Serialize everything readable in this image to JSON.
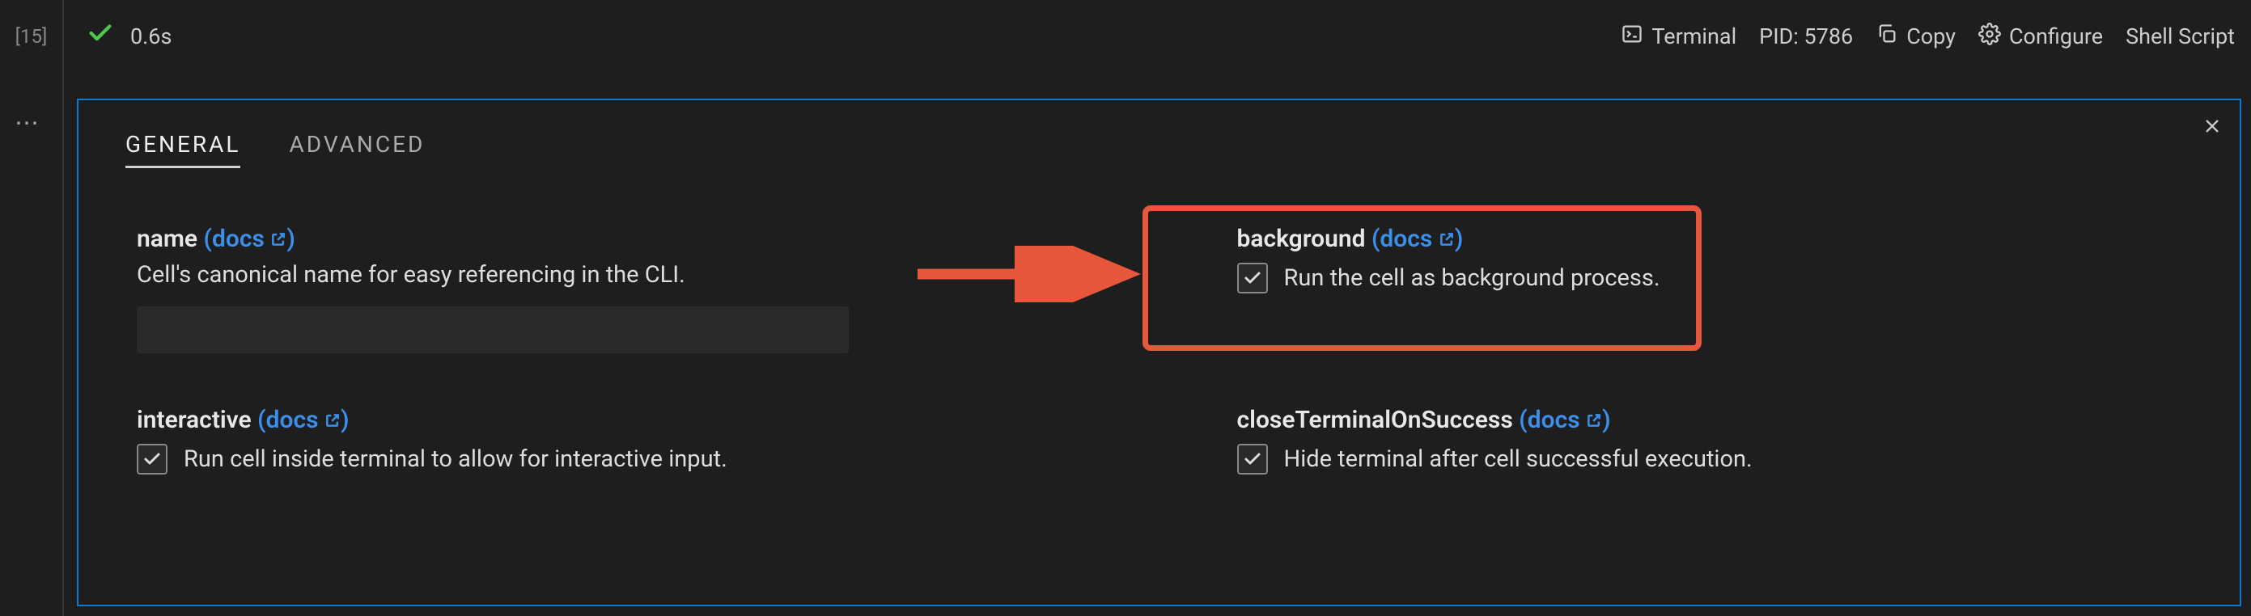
{
  "toolbar": {
    "cell_index": "[15]",
    "exec_time": "0.6s",
    "terminal_label": "Terminal",
    "pid_label": "PID: 5786",
    "copy_label": "Copy",
    "configure_label": "Configure",
    "language_label": "Shell Script"
  },
  "tabs": {
    "general": "GENERAL",
    "advanced": "ADVANCED"
  },
  "settings": {
    "name": {
      "title": "name",
      "docs": "docs",
      "desc": "Cell's canonical name for easy referencing in the CLI.",
      "value": ""
    },
    "background": {
      "title": "background",
      "docs": "docs",
      "checkbox_label": "Run the cell as background process."
    },
    "interactive": {
      "title": "interactive",
      "docs": "docs",
      "checkbox_label": "Run cell inside terminal to allow for interactive input."
    },
    "closeTerminal": {
      "title": "closeTerminalOnSuccess",
      "docs": "docs",
      "checkbox_label": "Hide terminal after cell successful execution."
    }
  },
  "annotation": {
    "highlight_color": "#e8563b"
  }
}
